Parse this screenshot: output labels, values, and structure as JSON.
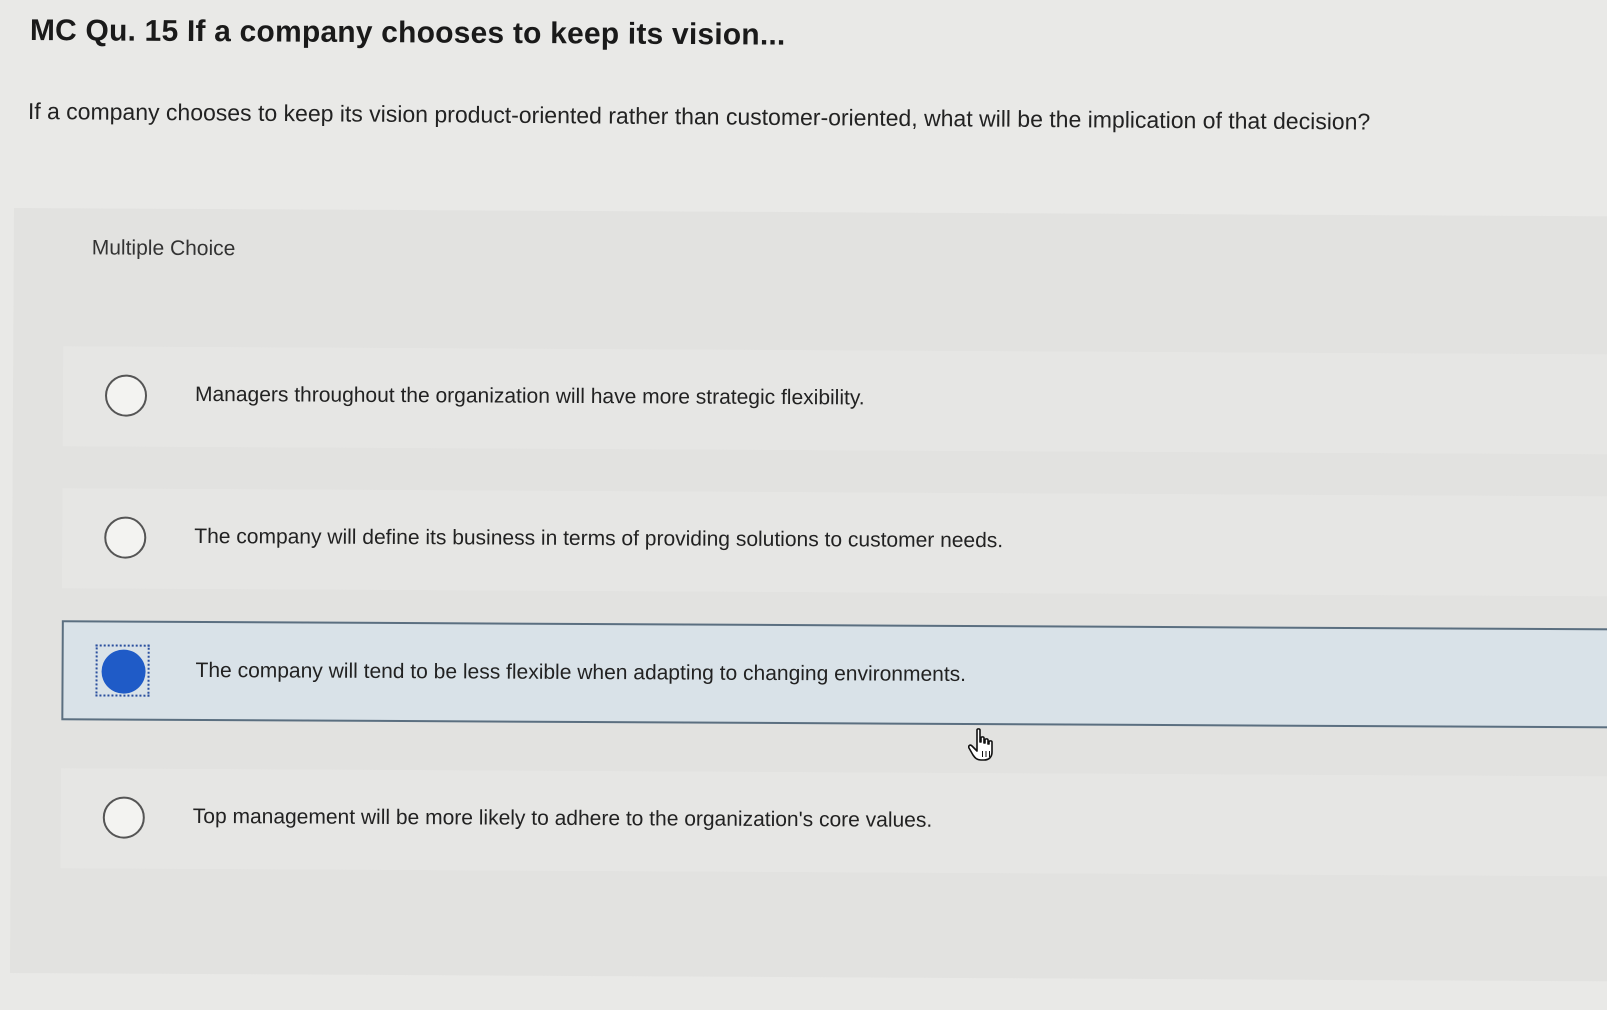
{
  "question": {
    "title": "MC Qu. 15 If a company chooses to keep its vision...",
    "text": "If a company chooses to keep its vision product-oriented rather than customer-oriented, what will be the implication of that decision?"
  },
  "multiple_choice": {
    "label": "Multiple Choice",
    "selected_index": 2,
    "options": [
      {
        "text": "Managers throughout the organization will have more strategic flexibility.",
        "selected": false
      },
      {
        "text": "The company will define its business in terms of providing solutions to customer needs.",
        "selected": false
      },
      {
        "text": "The company will tend to be less flexible when adapting to changing environments.",
        "selected": true
      },
      {
        "text": "Top management will be more likely to adhere to the organization's core values.",
        "selected": false
      }
    ]
  },
  "colors": {
    "selected_radio": "#1f5bc7",
    "selected_background": "#d9e2e8"
  },
  "icons": {
    "pointer": "hand-pointer-icon"
  }
}
